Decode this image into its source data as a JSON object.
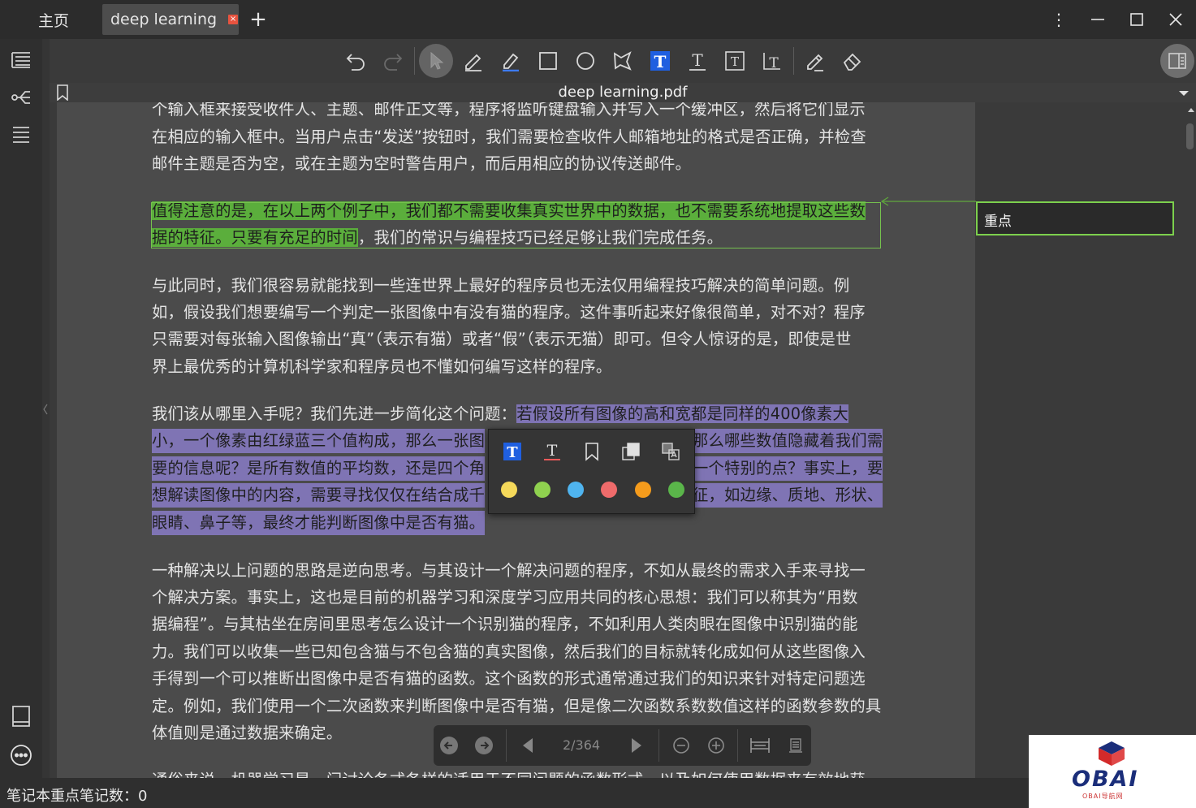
{
  "tabs": {
    "home": "主页",
    "doc": "deep learning",
    "close_glyph": "×",
    "new_tab_glyph": "+"
  },
  "window": {
    "menu_glyph": "⋮",
    "minimize_glyph": "—",
    "maximize_glyph": "☐",
    "close_glyph": "✕"
  },
  "doc_title": "deep learning.pdf",
  "paragraphs": {
    "p1": [
      "个输入框来接受收件人、主题、邮件正文等，程序将监听键盘输入并写入一个缓冲区，然后将它们显示",
      "在相应的输入框中。当用户点击“发送”按钮时，我们需要检查收件人邮箱地址的格式是否正确，并检查",
      "邮件主题是否为空，或在主题为空时警告用户，而后用相应的协议传送邮件。"
    ],
    "p2_line1": "值得注意的是，在以上两个例子中，我们都不需要收集真实世界中的数据，也不需要系统地提取这些数",
    "p2_line2_hl": "据的特征。只要有充足的时间",
    "p2_line2_rest": "，我们的常识与编程技巧已经足够让我们完成任务。",
    "p3": [
      "与此同时，我们很容易就能找到一些连世界上最好的程序员也无法仅用编程技巧解决的简单问题。例",
      "如，假设我们想要编写一个判定一张图像中有没有猫的程序。这件事听起来好像很简单，对不对？程序",
      "只需要对每张输入图像输出“真”（表示有猫）或者“假”（表示无猫）即可。但令人惊讶的是，即使是世",
      "界上最优秀的计算机科学家和程序员也不懂如何编写这样的程序。"
    ],
    "p4_line1_plain": "我们该从哪里入手呢？我们先进一步简化这个问题：",
    "p4_line1_hl": "若假设所有图像的高和宽都是同样的400像素大",
    "p4_l2a": "小，一个像素由红绿蓝三个值构成，那么一张图",
    "p4_l2b": "那么哪些数值隐藏着我们需",
    "p4_l3a": "要的信息呢？是所有数值的平均数，还是四个角",
    "p4_l3b": "一个特别的点？事实上，要",
    "p4_l4a": "想解读图像中的内容，需要寻找仅仅在结合成千",
    "p4_l4b": "征，如边缘、质地、形状、",
    "p4_l5": "眼睛、鼻子等，最终才能判断图像中是否有猫。",
    "p5": [
      "一种解决以上问题的思路是逆向思考。与其设计一个解决问题的程序，不如从最终的需求入手来寻找一",
      "个解决方案。事实上，这也是目前的机器学习和深度学习应用共同的核心思想：我们可以称其为“用数",
      "据编程”。与其枯坐在房间里思考怎么设计一个识别猫的程序，不如利用人类肉眼在图像中识别猫的能",
      "力。我们可以收集一些已知包含猫与不包含猫的真实图像，然后我们的目标就转化成如何从这些图像入",
      "手得到一个可以推断出图像中是否有猫的函数。这个函数的形式通常通过我们的知识来针对特定问题选",
      "定。例如，我们使用一个二次函数来判断图像中是否有猫，但是像二次函数系数数值这样的函数参数的具",
      "体值则是通过数据来确定。"
    ],
    "p6_partial": "通俗来说，机器学习是一门讨论各式各样的适用于不同问题的函数形式，以及如何使用数据来有效地获"
  },
  "note_card": "重点",
  "popup_colors": [
    "#f5d95a",
    "#8fd14f",
    "#4fb4ef",
    "#ef6b6b",
    "#f49b1c",
    "#5ab54a"
  ],
  "page_indicator": "2/364",
  "status_text": "笔记本重点笔记数：0",
  "logo": {
    "text": "OBAI",
    "sub": "OBAI导航网"
  },
  "colors": {
    "highlight_green": "#5bae3c",
    "highlight_purple": "#7f74b4",
    "text_tool_blue": "#1f5fe0"
  }
}
